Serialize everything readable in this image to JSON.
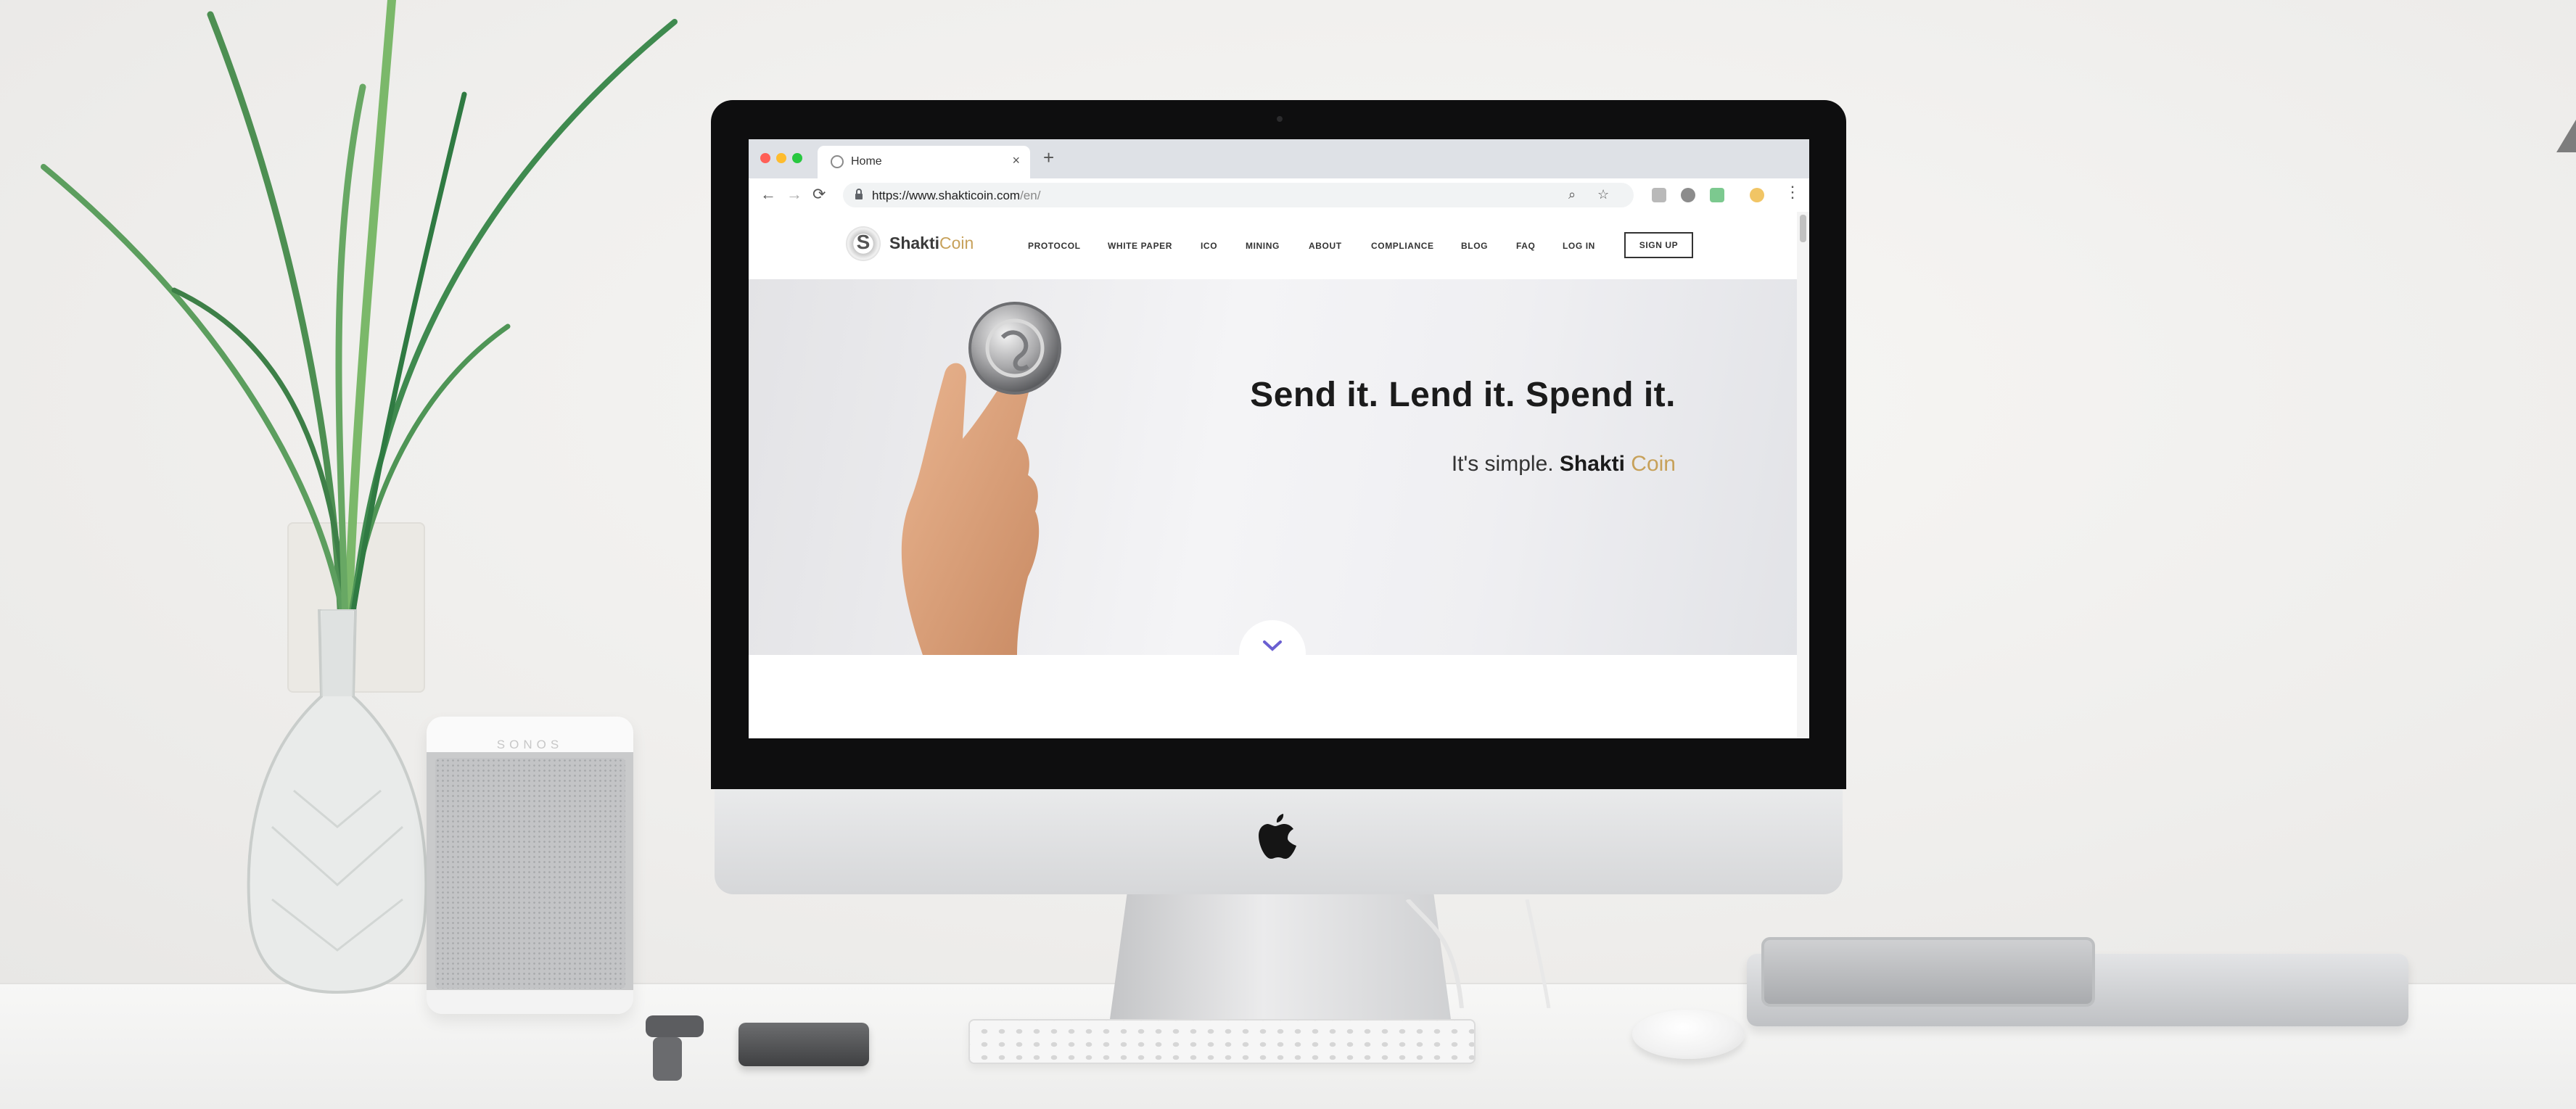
{
  "browser": {
    "tab_title": "Home",
    "tab_close": "×",
    "new_tab": "+",
    "back": "←",
    "forward": "→",
    "reload": "⟳",
    "url_main": "https://www.shakticoin.com",
    "url_path": "/en/",
    "menu": "⋮",
    "zoom_icon": "⌕",
    "star_icon": "☆"
  },
  "site": {
    "logo_mark": "S",
    "logo_name": "Shakti",
    "logo_name_accent": "Coin",
    "nav": [
      "PROTOCOL",
      "WHITE PAPER",
      "ICO",
      "MINING",
      "ABOUT",
      "COMPLIANCE",
      "BLOG",
      "FAQ",
      "LOG IN"
    ],
    "signup": "SIGN UP",
    "hero": {
      "headline": "Send it. Lend it. Spend it.",
      "tagline_prefix": "It's simple. ",
      "tagline_bold": "Shakti",
      "tagline_accent": " Coin"
    }
  },
  "scene": {
    "speaker_brand": "SONOS"
  },
  "colors": {
    "accent_gold": "#c7a15a",
    "traffic_red": "#ff5f57",
    "traffic_yellow": "#febc2e",
    "traffic_green": "#28c840"
  }
}
